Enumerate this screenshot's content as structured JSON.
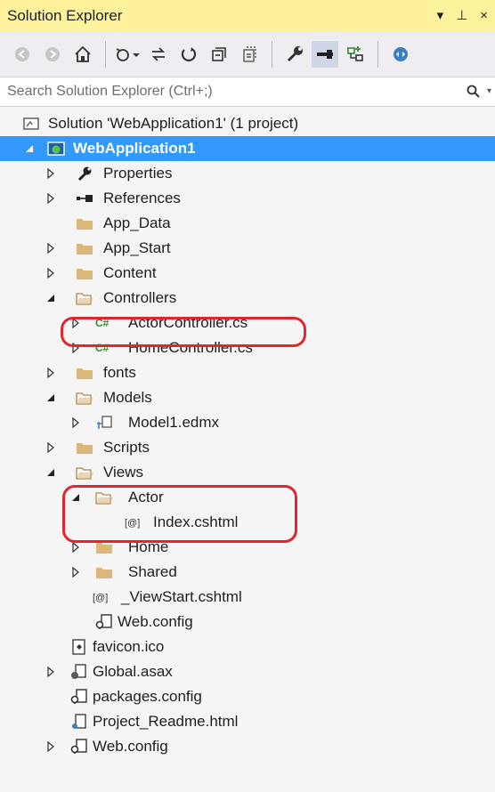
{
  "title_bar": {
    "title": "Solution Explorer",
    "dropdown_glyph": "▾",
    "pin_glyph": "⊥",
    "close_glyph": "×"
  },
  "search": {
    "placeholder": "Search Solution Explorer (Ctrl+;)"
  },
  "toolbar": {
    "buttons": [
      "back-icon",
      "forward-icon",
      "home-icon",
      "pending-changes-icon",
      "sync-icon",
      "refresh-icon",
      "collapse-all-icon",
      "show-all-files-icon",
      "properties-icon",
      "preview-icon",
      "class-view-icon",
      "browser-link-icon"
    ]
  },
  "tree": {
    "solution": "Solution 'WebApplication1' (1 project)",
    "project": "WebApplication1",
    "properties": "Properties",
    "references": "References",
    "app_data": "App_Data",
    "app_start": "App_Start",
    "content": "Content",
    "controllers": "Controllers",
    "actor_controller": "ActorController.cs",
    "home_controller": "HomeController.cs",
    "fonts": "fonts",
    "models": "Models",
    "model1": "Model1.edmx",
    "scripts": "Scripts",
    "views": "Views",
    "actor": "Actor",
    "index": "Index.cshtml",
    "home": "Home",
    "shared": "Shared",
    "viewstart": "_ViewStart.cshtml",
    "views_web_config": "Web.config",
    "favicon": "favicon.ico",
    "global": "Global.asax",
    "packages": "packages.config",
    "readme": "Project_Readme.html",
    "web_config": "Web.config"
  },
  "colors": {
    "title_bg": "#fff29d",
    "selection": "#3399ff",
    "highlight": "#e0262e",
    "folder": "#dcb67a",
    "csharp": "#388a34"
  }
}
